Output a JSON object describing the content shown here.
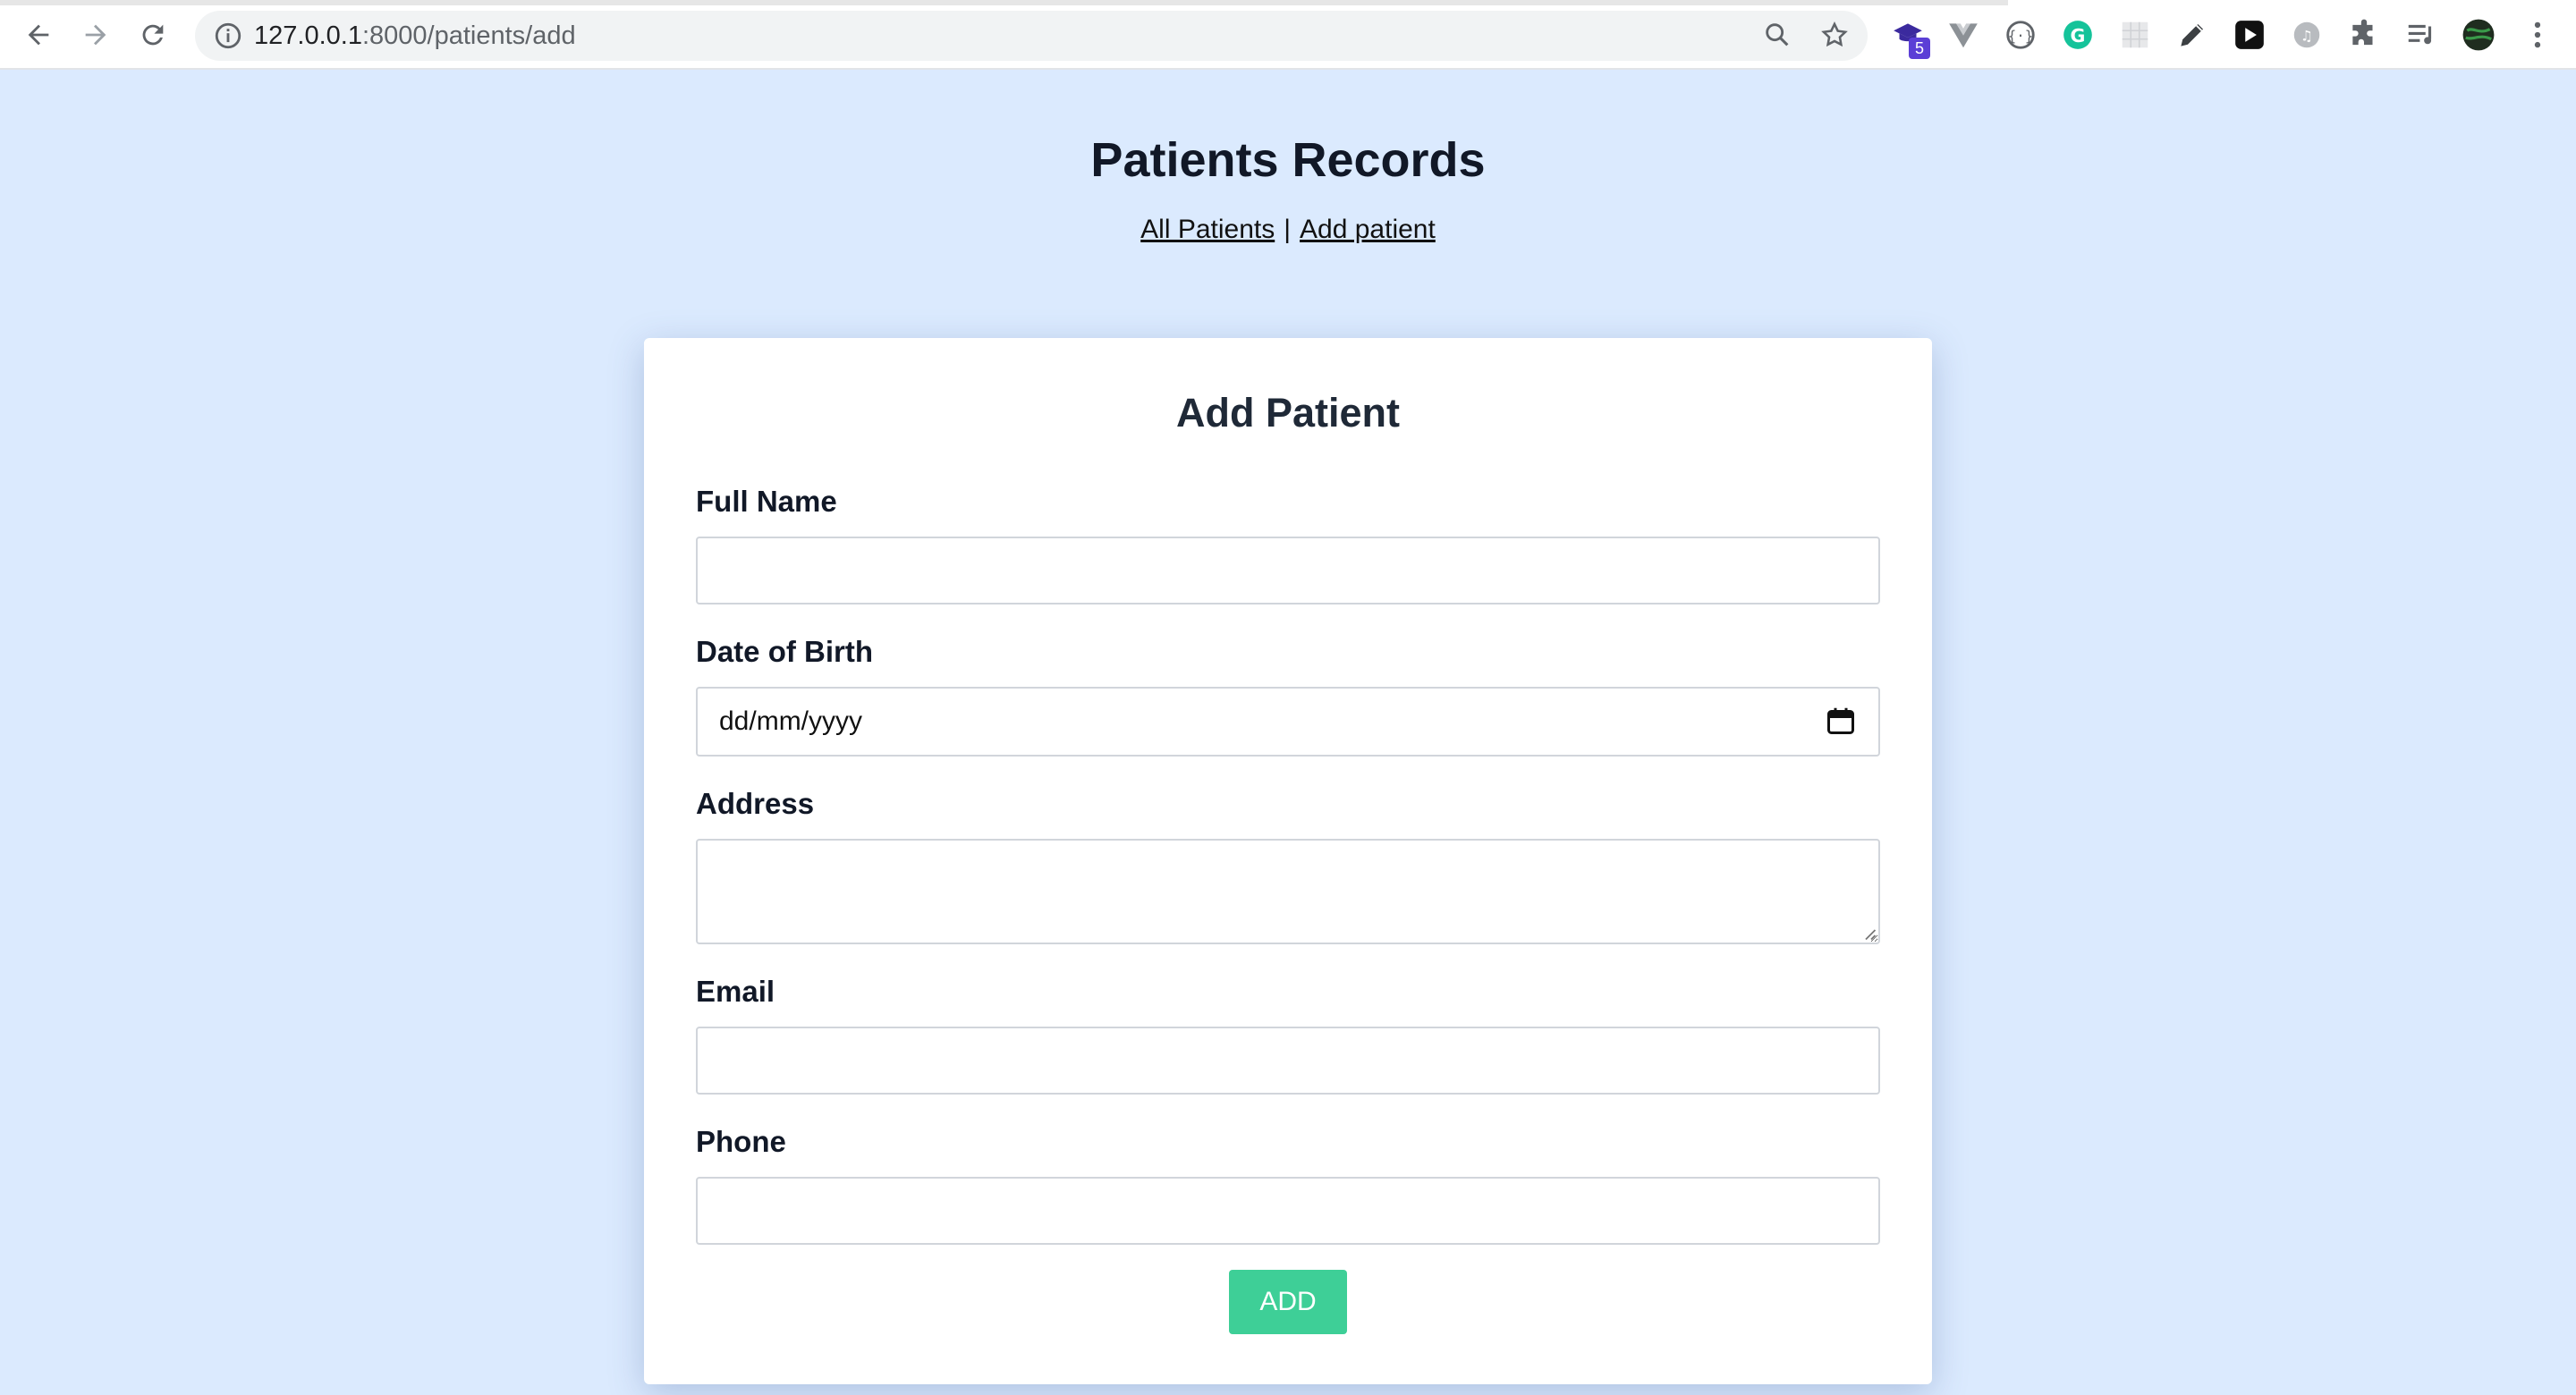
{
  "browser": {
    "url_host": "127.0.0.1",
    "url_path": ":8000/patients/add",
    "extension_badge": "5"
  },
  "header": {
    "title": "Patients Records",
    "nav": {
      "all_patients": "All Patients",
      "separator": "|",
      "add_patient": "Add patient"
    }
  },
  "form": {
    "title": "Add Patient",
    "fields": {
      "full_name": {
        "label": "Full Name",
        "value": ""
      },
      "dob": {
        "label": "Date of Birth",
        "placeholder": "dd/mm/yyyy"
      },
      "address": {
        "label": "Address",
        "value": ""
      },
      "email": {
        "label": "Email",
        "value": ""
      },
      "phone": {
        "label": "Phone",
        "value": ""
      }
    },
    "submit_label": "ADD"
  },
  "colors": {
    "page_bg": "#dbeafe",
    "button_bg": "#3ecf97",
    "card_bg": "#ffffff"
  }
}
